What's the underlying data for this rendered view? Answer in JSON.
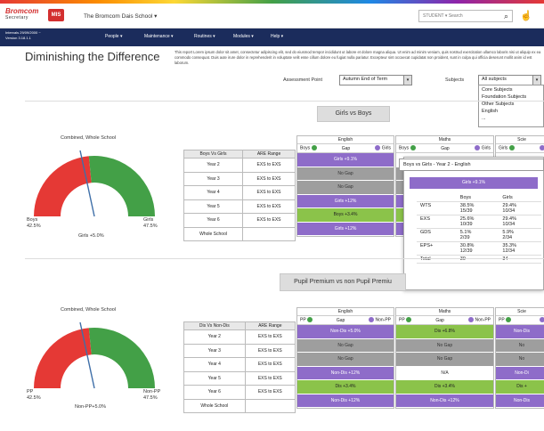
{
  "header": {
    "logo_top": "Bromcom",
    "logo_bottom": "Secretary",
    "logo_badge": "MIS",
    "school_name": "The Bromcom Dais School",
    "school_suffix": "▾",
    "search_scope": "STUDENT ▾",
    "search_placeholder": "Search"
  },
  "navbar": {
    "info_line1": "Intervals   29/09/2000 ~",
    "info_line2": "Version     3.18.1.1",
    "items": [
      "People ▾",
      "Maintenance ▾",
      "Routines ▾",
      "Modules ▾",
      "Help ▾"
    ]
  },
  "page": {
    "title": "Diminishing the Difference",
    "description": "This report Lorem ipsum dolor sit amet, consectetur adipiscing elit, sed do eiusmod tempor incididunt ut labore et dolore magna aliqua. Ut enim ad minim veniam, quis nostrud exercitation ullamco laboris nisi ut aliquip ex ea commodo consequat. Duis aute irure dolor in reprehenderit in voluptate velit esse cillum dolore eu fugiat nulla pariatur. Excepteur sint occaecat cupidatat non proident, sunt in culpa qui officia deserunt mollit anim id est laborum."
  },
  "filters": {
    "assessment_label": "Assessment Point",
    "assessment_value": "Autumn End of Term",
    "subjects_label": "Subjects",
    "subjects_value": "All subjects",
    "subject_options": [
      "Core Subjects",
      "Foundation Subjects",
      "Other Subjects",
      "English",
      "..."
    ]
  },
  "section1": {
    "heading": "Girls vs Boys",
    "gauge_caption": "Combined, Whole School",
    "gauge_left_label": "Boys",
    "gauge_left_value": "42.5%",
    "gauge_right_label": "Girls",
    "gauge_right_value": "47.5%",
    "gauge_center": "Girls +5.0%",
    "col1": "Boys Vs Girls",
    "col2": "ARE Range",
    "rows": [
      {
        "year": "Year 2",
        "range": "EXS to EXS"
      },
      {
        "year": "Year 3",
        "range": "EXS to EXS"
      },
      {
        "year": "Year 4",
        "range": "EXS to EXS"
      },
      {
        "year": "Year 5",
        "range": "EXS to EXS"
      },
      {
        "year": "Year 6",
        "range": "EXS to EXS"
      },
      {
        "year": "Whole School",
        "range": ""
      }
    ],
    "subjects": [
      {
        "name": "English",
        "left": "Boys",
        "gap": "Gap",
        "right": "Girls",
        "cells": [
          {
            "t": "Girls +9.1%",
            "c": "purple"
          },
          {
            "t": "No Gap",
            "c": "grey"
          },
          {
            "t": "No Gap",
            "c": "grey"
          },
          {
            "t": "Girls +12%",
            "c": "purple"
          },
          {
            "t": "Boys +3.4%",
            "c": "green"
          },
          {
            "t": "Girls +12%",
            "c": "purple"
          }
        ]
      },
      {
        "name": "Maths",
        "left": "Boys",
        "gap": "Gap",
        "right": "Girls",
        "cells": [
          {
            "t": "",
            "c": "white"
          },
          {
            "t": "",
            "c": "grey"
          },
          {
            "t": "",
            "c": "grey"
          },
          {
            "t": "",
            "c": "purple"
          },
          {
            "t": "",
            "c": "green"
          },
          {
            "t": "",
            "c": "purple"
          }
        ]
      },
      {
        "name": "Scie",
        "left": "Girls",
        "gap": "",
        "right": "",
        "cells": [
          {
            "t": "",
            "c": "white"
          },
          {
            "t": "",
            "c": "grey"
          },
          {
            "t": "",
            "c": "grey"
          },
          {
            "t": "",
            "c": "purple"
          },
          {
            "t": "",
            "c": "green"
          },
          {
            "t": "",
            "c": "purple"
          }
        ]
      }
    ]
  },
  "popup": {
    "title": "Boys vs Girls - Year 2 - English",
    "bar": "Girls +9.1%",
    "col_a": "Boys",
    "col_b": "Girls",
    "rows": [
      {
        "k": "WTS",
        "a": [
          "38.5%",
          "15/39"
        ],
        "b": [
          "29.4%",
          "10/34"
        ]
      },
      {
        "k": "EXS",
        "a": [
          "25.6%",
          "10/39"
        ],
        "b": [
          "29.4%",
          "10/34"
        ]
      },
      {
        "k": "GDS",
        "a": [
          "5.1%",
          "2/39"
        ],
        "b": [
          "5.9%",
          "2/34"
        ]
      },
      {
        "k": "EPS+",
        "a": [
          "30.8%",
          "12/39"
        ],
        "b": [
          "35.3%",
          "12/34"
        ]
      },
      {
        "k": "Total",
        "a": [
          "39"
        ],
        "b": [
          "34"
        ]
      }
    ]
  },
  "section2": {
    "heading": "Pupil Premium vs non Pupil Premiu",
    "gauge_caption": "Combined, Whole School",
    "gauge_left_label": "PP",
    "gauge_left_value": "42.5%",
    "gauge_right_label": "Non-PP",
    "gauge_right_value": "47.5%",
    "gauge_center": "Non-PP+5.0%",
    "col1": "Dis Vs Non-Dis",
    "col2": "ARE Range",
    "rows": [
      {
        "year": "Year 2",
        "range": "EXS to EXS"
      },
      {
        "year": "Year 3",
        "range": "EXS to EXS"
      },
      {
        "year": "Year 4",
        "range": "EXS to EXS"
      },
      {
        "year": "Year 5",
        "range": "EXS to EXS"
      },
      {
        "year": "Year 6",
        "range": "EXS to EXS"
      },
      {
        "year": "Whole School",
        "range": ""
      }
    ],
    "subjects": [
      {
        "name": "English",
        "left": "PP",
        "gap": "Gap",
        "right": "Non-PP",
        "cells": [
          {
            "t": "Non-Dis +5.0%",
            "c": "purple"
          },
          {
            "t": "No Gap",
            "c": "grey"
          },
          {
            "t": "No Gap",
            "c": "grey"
          },
          {
            "t": "Non-Dis +12%",
            "c": "purple"
          },
          {
            "t": "Dis +3.4%",
            "c": "green"
          },
          {
            "t": "Non-Dis +12%",
            "c": "purple"
          }
        ]
      },
      {
        "name": "Maths",
        "left": "PP",
        "gap": "Gap",
        "right": "Non-PP",
        "cells": [
          {
            "t": "Dis +6.8%",
            "c": "green"
          },
          {
            "t": "No Gap",
            "c": "grey"
          },
          {
            "t": "No Gap",
            "c": "grey"
          },
          {
            "t": "N/A",
            "c": "white"
          },
          {
            "t": "Dis +3.4%",
            "c": "green"
          },
          {
            "t": "Non-Dis +12%",
            "c": "purple"
          }
        ]
      },
      {
        "name": "Scie",
        "left": "PP",
        "gap": "",
        "right": "",
        "cells": [
          {
            "t": "Non-Dis",
            "c": "purple"
          },
          {
            "t": "No",
            "c": "grey"
          },
          {
            "t": "No",
            "c": "grey"
          },
          {
            "t": "Non-Di",
            "c": "purple"
          },
          {
            "t": "Dis +",
            "c": "green"
          },
          {
            "t": "Non-Dis",
            "c": "purple"
          }
        ]
      }
    ]
  },
  "colors": {
    "red": "#e53935",
    "green": "#43a047",
    "purple": "#8e6cc9",
    "navy": "#1b2c5c"
  }
}
